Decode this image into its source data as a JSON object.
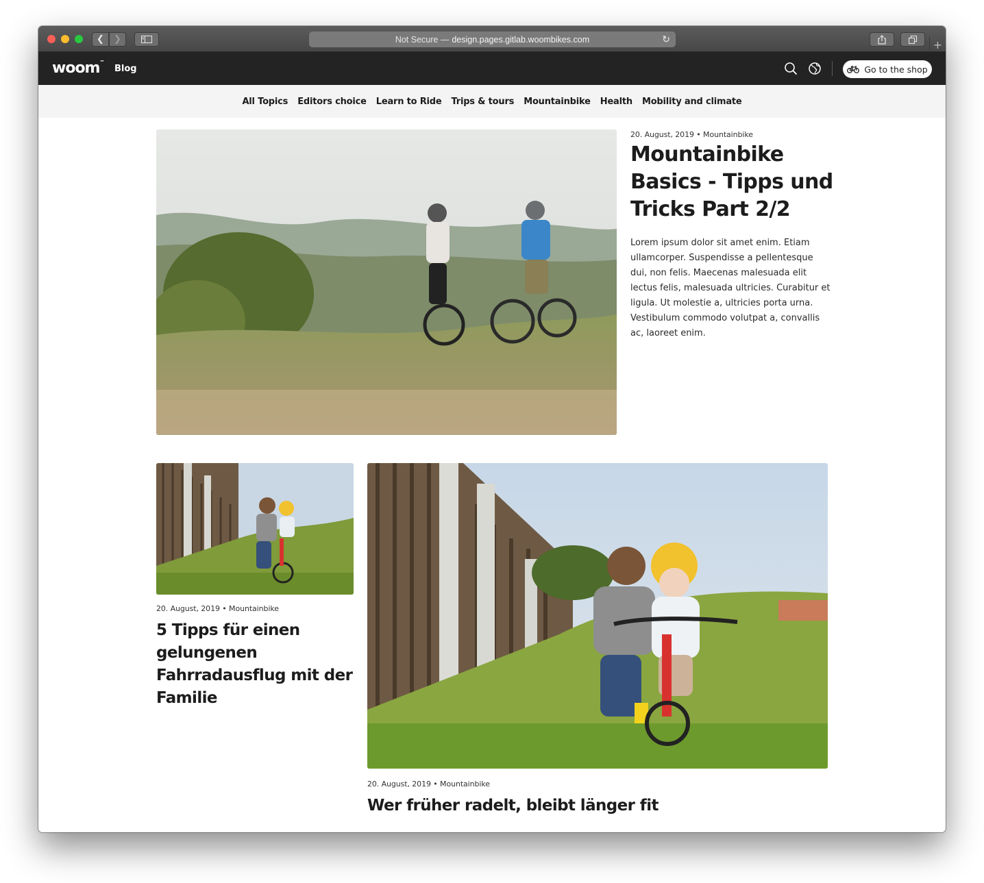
{
  "browser": {
    "url_security": "Not Secure —",
    "url_domain": "design.pages.gitlab.woombikes.com"
  },
  "header": {
    "logo": "woom",
    "logo_tm": "™",
    "blog_label": "Blog",
    "shop_button": "Go to the shop"
  },
  "categories": [
    "All Topics",
    "Editors choice",
    "Learn to Ride",
    "Trips & tours",
    "Mountainbike",
    "Health",
    "Mobility and climate"
  ],
  "hero": {
    "meta": "20. August, 2019 • Mountainbike",
    "title": "Mountainbike Basics - Tipps und Tricks Part 2/2",
    "excerpt": "Lorem ipsum dolor sit amet enim. Etiam ullamcorper. Suspendisse a pellentesque dui, non felis. Maecenas malesuada elit lectus felis, malesuada ultricies. Curabitur et ligula. Ut molestie a, ultricies porta urna. Vestibulum commodo volutpat a, convallis ac, laoreet enim."
  },
  "cards": [
    {
      "meta": "20. August, 2019 • Mountainbike",
      "title": "5 Tipps für einen gelungenen Fahrradausflug mit der Familie"
    },
    {
      "meta": "20. August, 2019 • Mountainbike",
      "title": "Wer früher radelt, bleibt länger fit"
    }
  ],
  "colors": {
    "header_bg": "#232324",
    "nav_bg": "#f4f4f4",
    "text": "#1c1c1c"
  },
  "icons": {
    "search": "search-icon",
    "language": "globe-icon",
    "bike": "bike-icon",
    "reload": "reload-icon"
  }
}
